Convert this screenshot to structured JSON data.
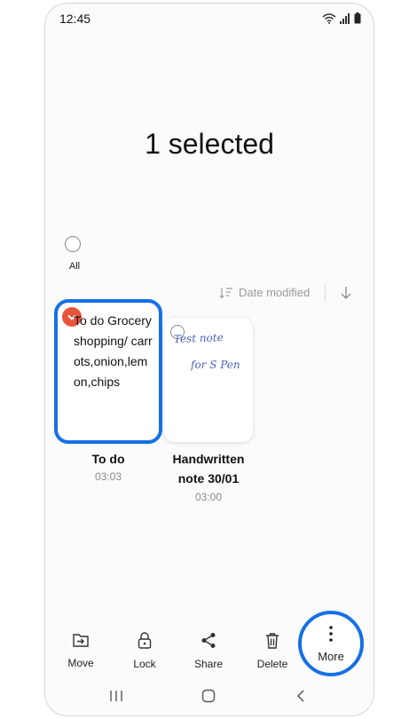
{
  "status_bar": {
    "time": "12:45"
  },
  "header": {
    "title": "1 selected"
  },
  "select_all": {
    "label": "All"
  },
  "sort": {
    "label": "Date modified"
  },
  "notes": [
    {
      "title": "To do",
      "time": "03:03",
      "preview": "To do Grocery shopping/ carrots,onion,lemon,chips",
      "selected": true
    },
    {
      "title": "Handwritten note 30/01",
      "time": "03:00",
      "preview": "Test note for S Pen",
      "selected": false
    }
  ],
  "bottom_actions": [
    {
      "label": "Move",
      "icon": "move-icon"
    },
    {
      "label": "Lock",
      "icon": "lock-icon"
    },
    {
      "label": "Share",
      "icon": "share-icon"
    },
    {
      "label": "Delete",
      "icon": "trash-icon"
    },
    {
      "label": "More",
      "icon": "more-vertical-icon"
    }
  ],
  "colors": {
    "accent": "#1670e6",
    "check": "#e9543c",
    "handwriting": "#4a63b8"
  }
}
